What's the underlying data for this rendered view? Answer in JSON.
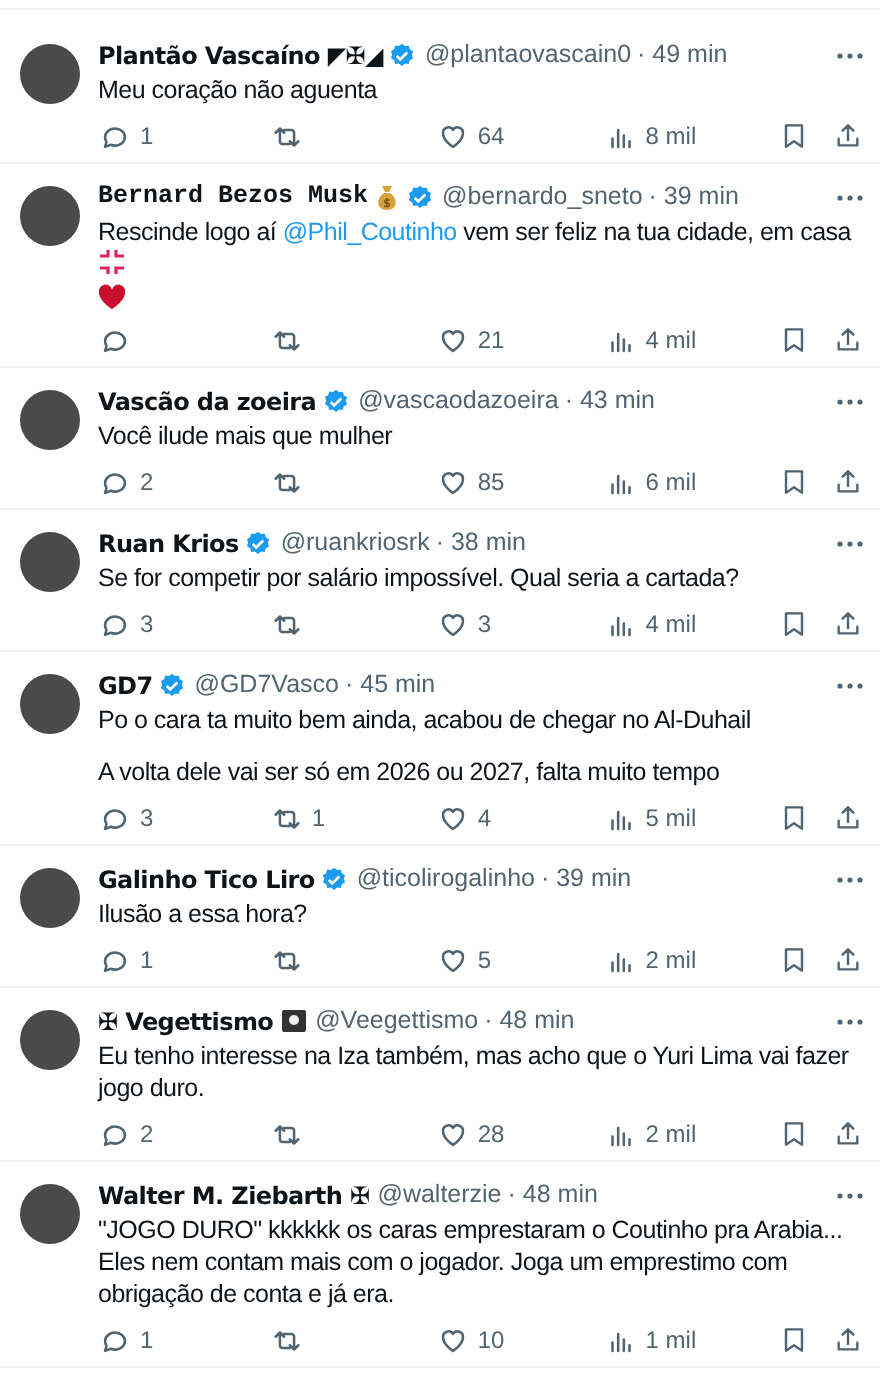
{
  "tweets": [
    {
      "kind": "plain",
      "name": "Plantão Vascaíno ◤✠◢",
      "verified": true,
      "handle": "@plantaovascain0",
      "time": "· 49 min",
      "body": [
        {
          "kind": "text",
          "text": "Meu coração não aguenta"
        }
      ],
      "replies": "1",
      "likes": "64",
      "views": "8 mil"
    },
    {
      "kind": "mono",
      "name": "Bernard Bezos Musk",
      "badges": [
        {
          "kind": "money-bag"
        }
      ],
      "verified": true,
      "handle": "@bernardo_sneto",
      "time": "· 39 min",
      "body": [
        {
          "kind": "text",
          "text": "Rescinde logo aí "
        },
        {
          "kind": "mention",
          "text": "@Phil_Coutinho"
        },
        {
          "kind": "text",
          "text": " vem ser feliz na tua cidade, em casa "
        },
        {
          "kind": "anger"
        },
        {
          "kind": "heart"
        }
      ],
      "likes": "21",
      "views": "4 mil"
    },
    {
      "kind": "plain",
      "name": "Vascão da zoeira",
      "verified": true,
      "handle": "@vascaodazoeira",
      "time": "· 43 min",
      "body": [
        {
          "kind": "text",
          "text": "Você ilude mais que mulher"
        }
      ],
      "replies": "2",
      "likes": "85",
      "views": "6 mil"
    },
    {
      "kind": "plain",
      "name": "Ruan Krios",
      "verified": true,
      "handle": "@ruankriosrk",
      "time": "· 38 min",
      "body": [
        {
          "kind": "text",
          "text": "Se for competir por salário impossível. Qual seria a cartada?"
        }
      ],
      "replies": "3",
      "likes": "3",
      "views": "4 mil"
    },
    {
      "kind": "plain",
      "name": "GD7",
      "verified": true,
      "handle": "@GD7Vasco",
      "time": "· 45 min",
      "body": [
        {
          "kind": "text",
          "text": "Po o cara ta muito bem ainda, acabou de chegar no Al-Duhail"
        },
        {
          "kind": "break"
        },
        {
          "kind": "text",
          "text": " A volta dele vai ser só em 2026 ou 2027, falta muito tempo"
        }
      ],
      "replies": "3",
      "reposts": "1",
      "likes": "4",
      "views": "5 mil"
    },
    {
      "kind": "plain",
      "name": "Galinho Tico Liro",
      "verified": true,
      "handle": "@ticolirogalinho",
      "time": "· 39 min",
      "body": [
        {
          "kind": "text",
          "text": "Ilusão a essa hora?"
        }
      ],
      "replies": "1",
      "likes": "5",
      "views": "2 mil"
    },
    {
      "kind": "plain",
      "name": "✠ Vegettismo",
      "badges": [
        {
          "kind": "flag"
        }
      ],
      "verified": false,
      "handle": "@Veegettismo",
      "time": "· 48 min",
      "body": [
        {
          "kind": "text",
          "text": "Eu tenho interesse na Iza também, mas acho que o Yuri Lima vai fazer jogo duro."
        }
      ],
      "replies": "2",
      "likes": "28",
      "views": "2 mil"
    },
    {
      "kind": "plain",
      "name": "Walter M. Ziebarth ✠",
      "verified": false,
      "handle": "@walterzie",
      "time": "· 48 min",
      "body": [
        {
          "kind": "text",
          "text": "\"JOGO DURO\" kkkkkk os caras emprestaram o Coutinho pra Arabia... Eles nem contam mais com o jogador. Joga um emprestimo com obrigação de conta e já era."
        }
      ],
      "replies": "1",
      "likes": "10",
      "views": "1 mil"
    }
  ]
}
